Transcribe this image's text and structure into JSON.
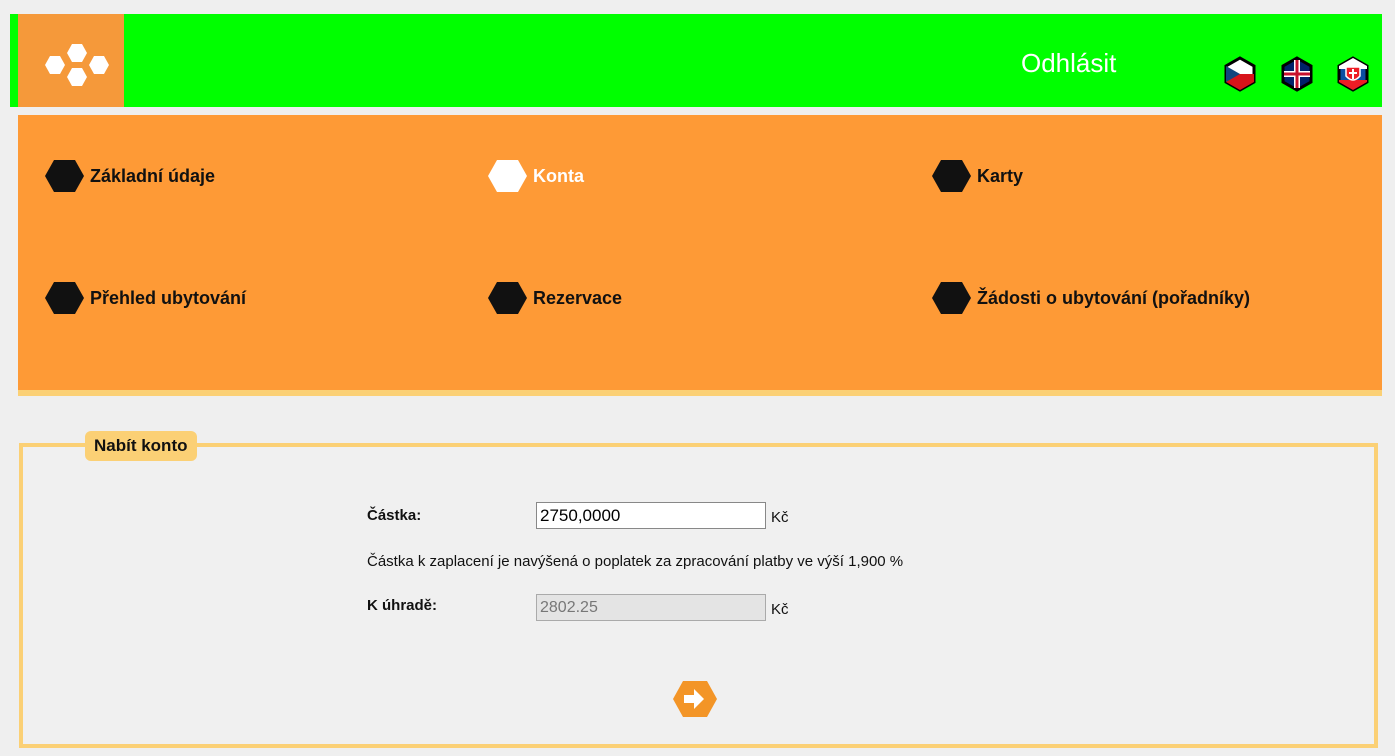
{
  "header": {
    "logout_label": "Odhlásit",
    "colors": {
      "bar": "#00ff00",
      "logo_bg": "#f5993a"
    },
    "flags": [
      {
        "name": "czech-flag-icon",
        "lang": "cs"
      },
      {
        "name": "uk-flag-icon",
        "lang": "en"
      },
      {
        "name": "slovak-flag-icon",
        "lang": "sk"
      }
    ]
  },
  "nav": {
    "items": [
      {
        "label": "Základní údaje",
        "active": false
      },
      {
        "label": "Konta",
        "active": true
      },
      {
        "label": "Karty",
        "active": false
      },
      {
        "label": "Přehled ubytování",
        "active": false
      },
      {
        "label": "Rezervace",
        "active": false
      },
      {
        "label": "Žádosti o ubytování (pořadníky)",
        "active": false
      }
    ]
  },
  "form": {
    "legend": "Nabít konto",
    "amount_label": "Částka:",
    "amount_value": "2750,0000",
    "amount_unit": "Kč",
    "fee_note": "Částka k zaplacení je navýšená o poplatek za zpracování platby ve výší 1,900 %",
    "due_label": "K úhradě:",
    "due_value": "2802.25",
    "due_unit": "Kč",
    "submit_icon": "arrow-right-icon"
  }
}
